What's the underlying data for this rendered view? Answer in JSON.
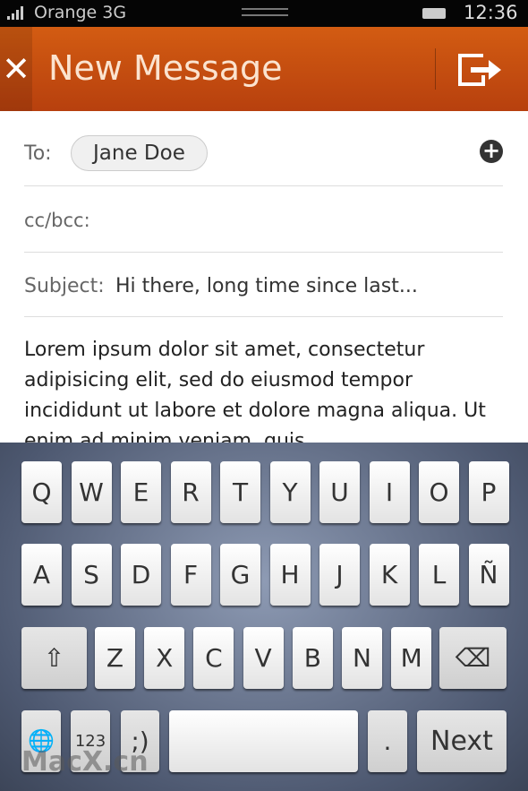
{
  "status": {
    "carrier": "Orange 3G",
    "time": "12:36"
  },
  "header": {
    "close_icon": "close-icon",
    "title": "New Message",
    "send_icon": "send-icon"
  },
  "compose": {
    "to_label": "To:",
    "recipient": "Jane Doe",
    "add_icon": "plus-circle-icon",
    "cc_label": "cc/bcc:",
    "subject_label": "Subject:",
    "subject_value": "Hi there, long time since last...",
    "body": "Lorem ipsum dolor sit amet, consectetur adipisicing elit, sed do eiusmod tempor incididunt ut labore et dolore magna aliqua. Ut enim ad minim veniam, quis"
  },
  "keyboard": {
    "row1": [
      "Q",
      "W",
      "E",
      "R",
      "T",
      "Y",
      "U",
      "I",
      "O",
      "P"
    ],
    "row2": [
      "A",
      "S",
      "D",
      "F",
      "G",
      "H",
      "J",
      "K",
      "L",
      "Ñ"
    ],
    "row3": [
      "Z",
      "X",
      "C",
      "V",
      "B",
      "N",
      "M"
    ],
    "shift": "⇧",
    "backspace": "⌫",
    "globe": "🌐",
    "numbers": "123",
    "emoticon": ";)",
    "period": ".",
    "next": "Next"
  },
  "watermark": "MacX.cn"
}
